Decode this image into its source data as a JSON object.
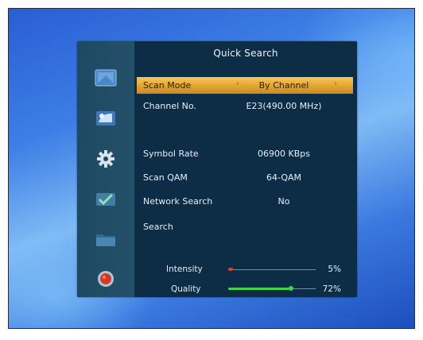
{
  "menu": {
    "title": "Quick Search",
    "items": [
      {
        "label": "Scan Mode",
        "value": "By Channel",
        "selected": true
      },
      {
        "label": "Channel No.",
        "value": "E23(490.00 MHz)"
      },
      {
        "label": "",
        "value": "",
        "disabled": true
      },
      {
        "label": "Symbol Rate",
        "value": "06900 KBps"
      },
      {
        "label": "Scan QAM",
        "value": "64-QAM"
      },
      {
        "label": "Network Search",
        "value": "No"
      },
      {
        "label": "Search",
        "value": ""
      }
    ],
    "arrows": {
      "left": "‹",
      "right": "›"
    }
  },
  "signal": {
    "intensity": {
      "label": "Intensity",
      "percent_text": "5%",
      "level": 0.05
    },
    "quality": {
      "label": "Quality",
      "percent_text": "72%",
      "level": 0.72
    }
  },
  "sidebar": {
    "icons": [
      "tv-icon",
      "satellite-icon",
      "settings-gear-icon",
      "check-icon",
      "folder-icon",
      "record-icon"
    ]
  },
  "colors": {
    "highlight": "#e4a736",
    "panel": "#0d2d46",
    "intensity_bar": "#e03a2a",
    "quality_bar": "#3ed44a"
  }
}
